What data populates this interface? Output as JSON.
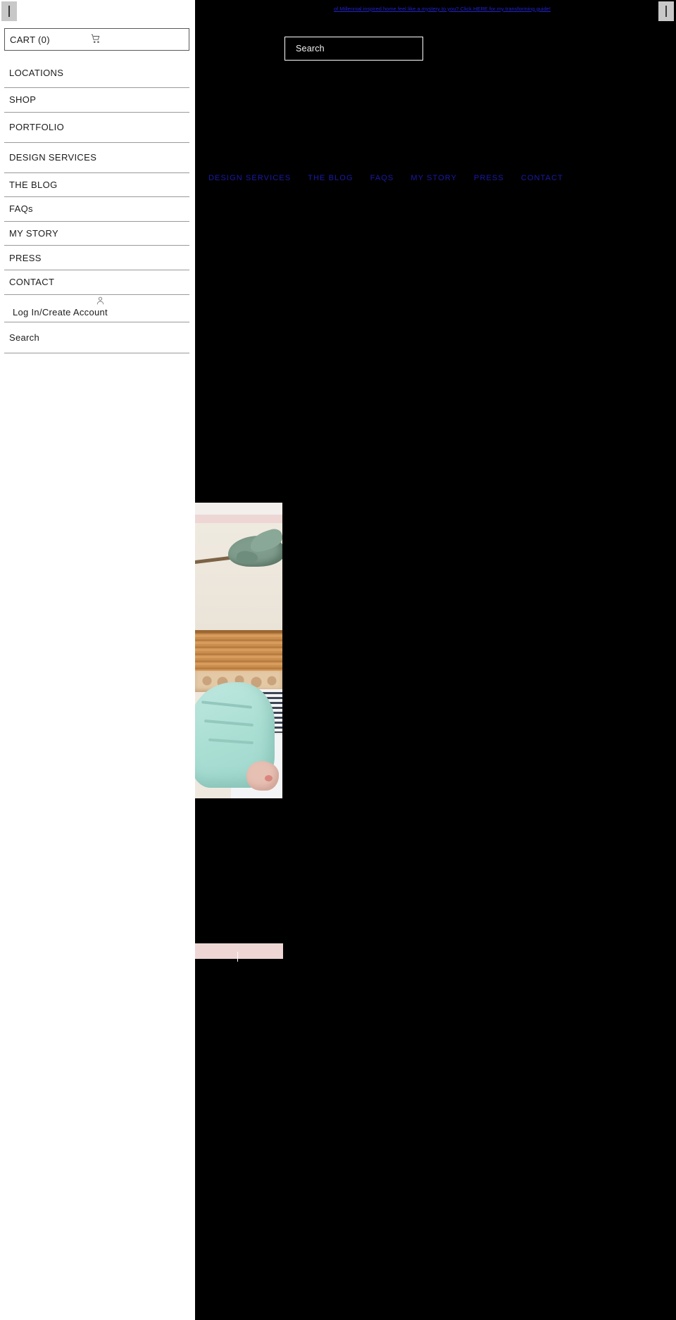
{
  "announcement": {
    "text": "of Millennial inspired home feel like a mystery to you? Click HERE for my transforming guide!",
    "link_color": "#2222cc"
  },
  "window_handles": {
    "left_handle_name": "resize-handle-left",
    "right_handle_name": "resize-handle-right"
  },
  "search": {
    "label": "Search",
    "placeholder": "Search"
  },
  "topnav": {
    "links": [
      {
        "label": "DESIGN SERVICES"
      },
      {
        "label": "THE BLOG"
      },
      {
        "label": "FAQS"
      },
      {
        "label": "MY STORY"
      },
      {
        "label": "PRESS"
      },
      {
        "label": "CONTACT"
      }
    ],
    "color": "#1a1aa8"
  },
  "drawer": {
    "cart": {
      "label": "CART (0)",
      "icon": "shopping-cart-icon",
      "count": 0
    },
    "items": [
      {
        "label": "LOCATIONS"
      },
      {
        "label": "SHOP"
      },
      {
        "label": "PORTFOLIO"
      },
      {
        "label": "DESIGN SERVICES"
      },
      {
        "label": "THE BLOG"
      },
      {
        "label": "FAQs"
      },
      {
        "label": "MY STORY"
      },
      {
        "label": "PRESS"
      },
      {
        "label": "CONTACT"
      }
    ],
    "account": {
      "label": "Log In/Create Account",
      "icon": "user-icon"
    },
    "search": {
      "label": "Search"
    }
  },
  "hero": {
    "alt": "woman in mint sweater on bed with heart print duvet and wooden headboard",
    "accent_pink": "#edd6d4",
    "background": "#000000"
  }
}
